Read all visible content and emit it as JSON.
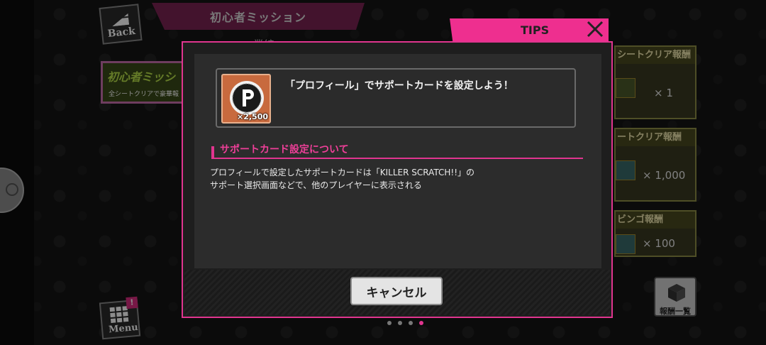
{
  "header": {
    "back_label": "Back",
    "title": "初心者ミッション",
    "subtitle_peek": "…業編"
  },
  "beginner_badge": {
    "title": "初心者ミッシ",
    "subtitle": "全シートクリアで豪華報"
  },
  "reward_panels": [
    {
      "title": "シートクリア報酬",
      "count": "× 1"
    },
    {
      "title": "ートクリア報酬",
      "count": "× 1,000"
    },
    {
      "title": "ビンゴ報酬",
      "count": "× 100"
    }
  ],
  "menu": {
    "label": "Menu",
    "badge": "!"
  },
  "rewards_list_label": "報酬一覧",
  "tips": {
    "tab_label": "TIPS",
    "mission_text": "「プロフィール」でサポートカードを設定しよう！",
    "reward_quantity": "×2,500",
    "section_heading": "サポートカード設定について",
    "description_line1": "プロフィールで設定したサポートカードは「KILLER SCRATCH!!」の",
    "description_line2": "サポート選択画面などで、他のプレイヤーに表示される",
    "cancel_label": "キャンセル"
  },
  "pagination": {
    "count": 4,
    "active_index": 3
  },
  "colors": {
    "accent_pink": "#e0358f",
    "reward_orange": "#c86a3e"
  }
}
